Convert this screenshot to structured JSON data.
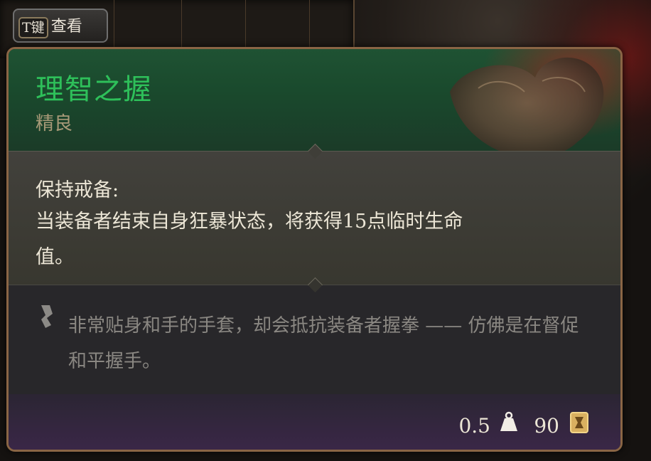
{
  "hint": {
    "key": "T键",
    "label": "查看"
  },
  "item": {
    "name": "理智之握",
    "rarity": "精良",
    "effect_name": "保持戒备:",
    "effect_text": "当装备者结束自身狂暴状态，将获得15点临时生命值。",
    "lore": "非常贴身和手的手套，却会抵抗装备者握拳 —— 仿佛是在督促和平握手。",
    "weight": "0.5",
    "value": "90"
  },
  "icons": {
    "weight": "weight-icon",
    "gold": "gold-icon",
    "lore": "quill-icon",
    "item_art": "glove-art"
  },
  "colors": {
    "name": "#2ec05a",
    "rarity": "#a89a78",
    "border": "#8a6545"
  }
}
